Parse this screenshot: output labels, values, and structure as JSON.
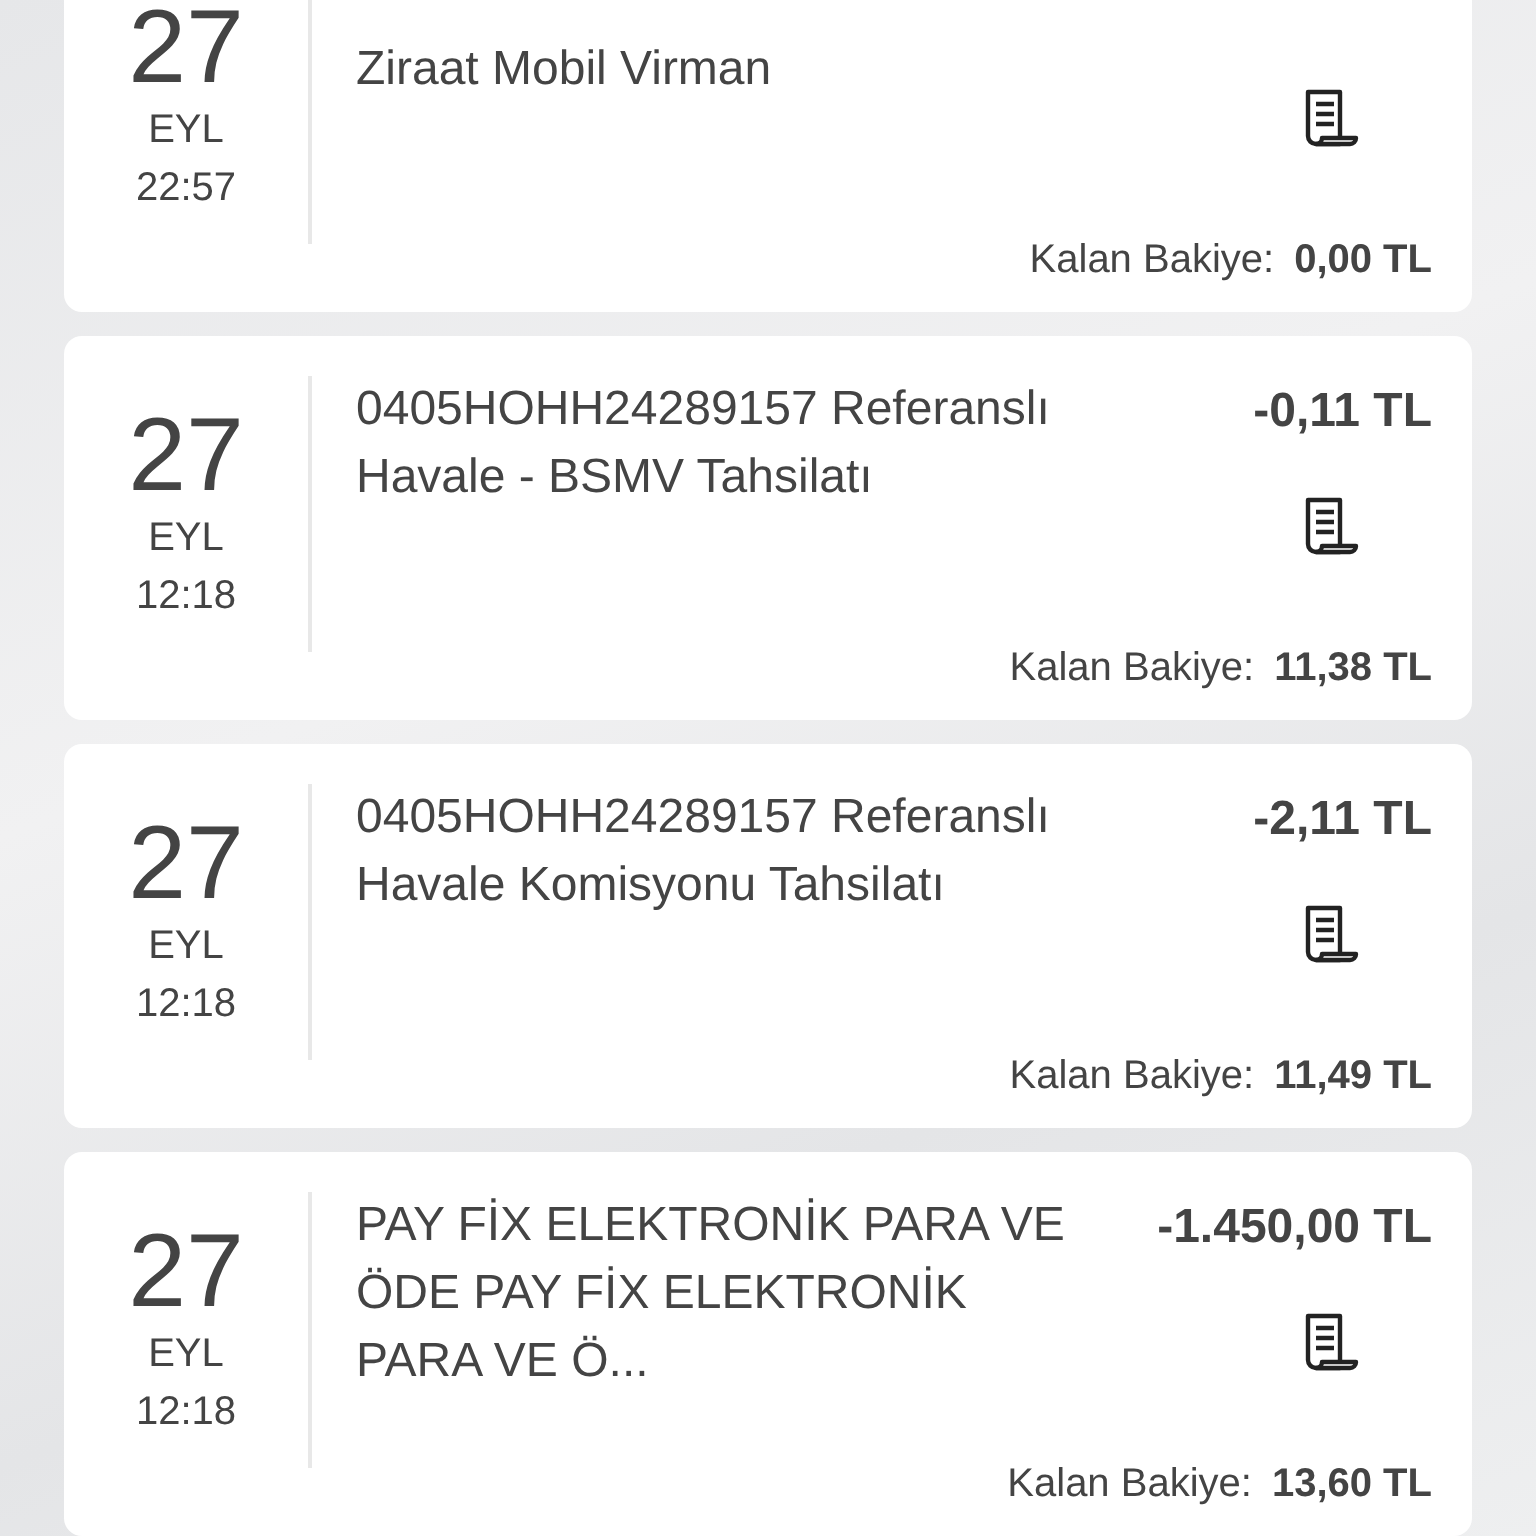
{
  "transactions": [
    {
      "day": "27",
      "month": "EYL",
      "time": "22:57",
      "description": "Ziraat Mobil Virman",
      "balance_label": "Kalan Bakiye:",
      "balance": "0,00 TL"
    },
    {
      "day": "27",
      "month": "EYL",
      "time": "12:18",
      "description": "0405HOHH24289157 Referanslı Havale - BSMV Tahsilatı",
      "amount": "-0,11 TL",
      "balance_label": "Kalan Bakiye:",
      "balance": "11,38 TL"
    },
    {
      "day": "27",
      "month": "EYL",
      "time": "12:18",
      "description": "0405HOHH24289157 Referanslı Havale Komisyonu Tahsilatı",
      "amount": "-2,11 TL",
      "balance_label": "Kalan Bakiye:",
      "balance": "11,49 TL"
    },
    {
      "day": "27",
      "month": "EYL",
      "time": "12:18",
      "description": "PAY FİX ELEKTRONİK PARA VE ÖDE PAY FİX ELEKTRONİK PARA VE Ö...",
      "amount": "-1.450,00 TL",
      "balance_label": "Kalan Bakiye:",
      "balance": "13,60 TL"
    }
  ]
}
